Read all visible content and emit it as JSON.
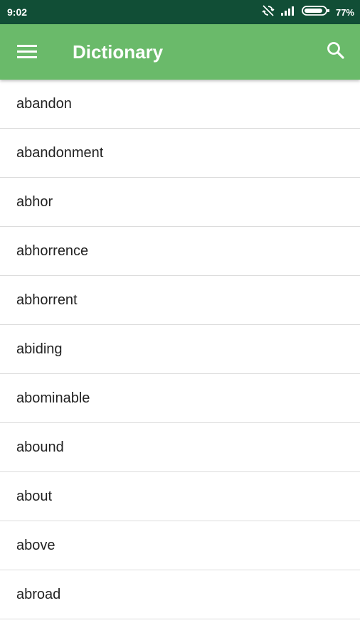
{
  "status_bar": {
    "time": "9:02",
    "battery": "77%",
    "icons": [
      "sync-off-icon",
      "signal-icon",
      "battery-icon"
    ]
  },
  "app_bar": {
    "title": "Dictionary",
    "menu_icon": "hamburger-menu-icon",
    "search_icon": "search-icon"
  },
  "colors": {
    "status_bar": "#114e36",
    "app_bar": "#6aba6a",
    "text": "#222222",
    "divider": "#dcdcdc"
  },
  "words": [
    "abandon",
    "abandonment",
    "abhor",
    "abhorrence",
    "abhorrent",
    "abiding",
    "abominable",
    "abound",
    "about",
    "above",
    "abroad"
  ]
}
